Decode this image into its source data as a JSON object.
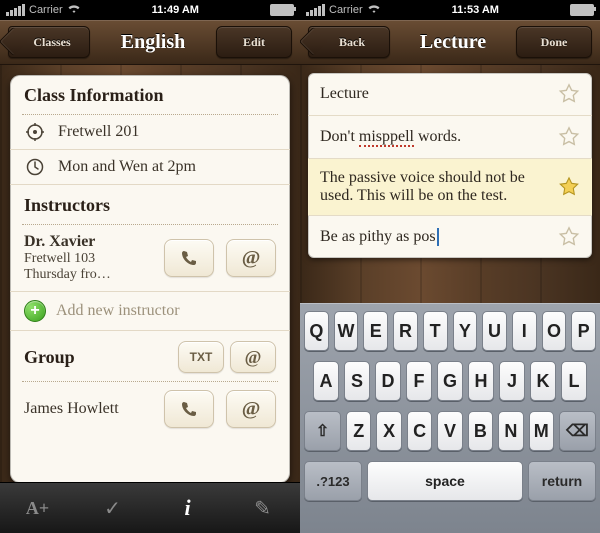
{
  "left": {
    "status": {
      "carrier": "Carrier",
      "wifi": "wifi",
      "time": "11:49 AM"
    },
    "nav": {
      "back": "Classes",
      "title": "English",
      "right": "Edit"
    },
    "class_info": {
      "heading": "Class Information",
      "location": "Fretwell 201",
      "schedule": "Mon and Wen at 2pm"
    },
    "instructors": {
      "heading": "Instructors",
      "items": [
        {
          "name": "Dr. Xavier",
          "room": "Fretwell 103",
          "hours": "Thursday fro…"
        }
      ],
      "add_label": "Add new instructor"
    },
    "group": {
      "heading": "Group",
      "txt_label": "TXT",
      "items": [
        {
          "name": "James Howlett"
        }
      ]
    },
    "tabs": {
      "grade": "A+",
      "check": "✓",
      "info": "i",
      "edit": "✎"
    }
  },
  "right": {
    "status": {
      "carrier": "Carrier",
      "wifi": "wifi",
      "time": "11:53 AM"
    },
    "nav": {
      "back": "Back",
      "title": "Lecture",
      "right": "Done"
    },
    "notes": [
      {
        "text": "Lecture",
        "starred": false,
        "highlight": false
      },
      {
        "text_parts": [
          "Don't ",
          "misppell",
          " words."
        ],
        "misspell_index": 1,
        "starred": false,
        "highlight": false
      },
      {
        "text": "The passive voice should not be used. This will be on the test.",
        "starred": true,
        "highlight": true
      },
      {
        "text": "Be as pithy as pos",
        "editing": true,
        "starred": false,
        "highlight": false
      }
    ],
    "keyboard": {
      "rows": [
        [
          "Q",
          "W",
          "E",
          "R",
          "T",
          "Y",
          "U",
          "I",
          "O",
          "P"
        ],
        [
          "A",
          "S",
          "D",
          "F",
          "G",
          "H",
          "J",
          "K",
          "L"
        ],
        [
          "⇧",
          "Z",
          "X",
          "C",
          "V",
          "B",
          "N",
          "M",
          "⌫"
        ]
      ],
      "sym": ".?123",
      "space": "space",
      "ret": "return"
    }
  }
}
